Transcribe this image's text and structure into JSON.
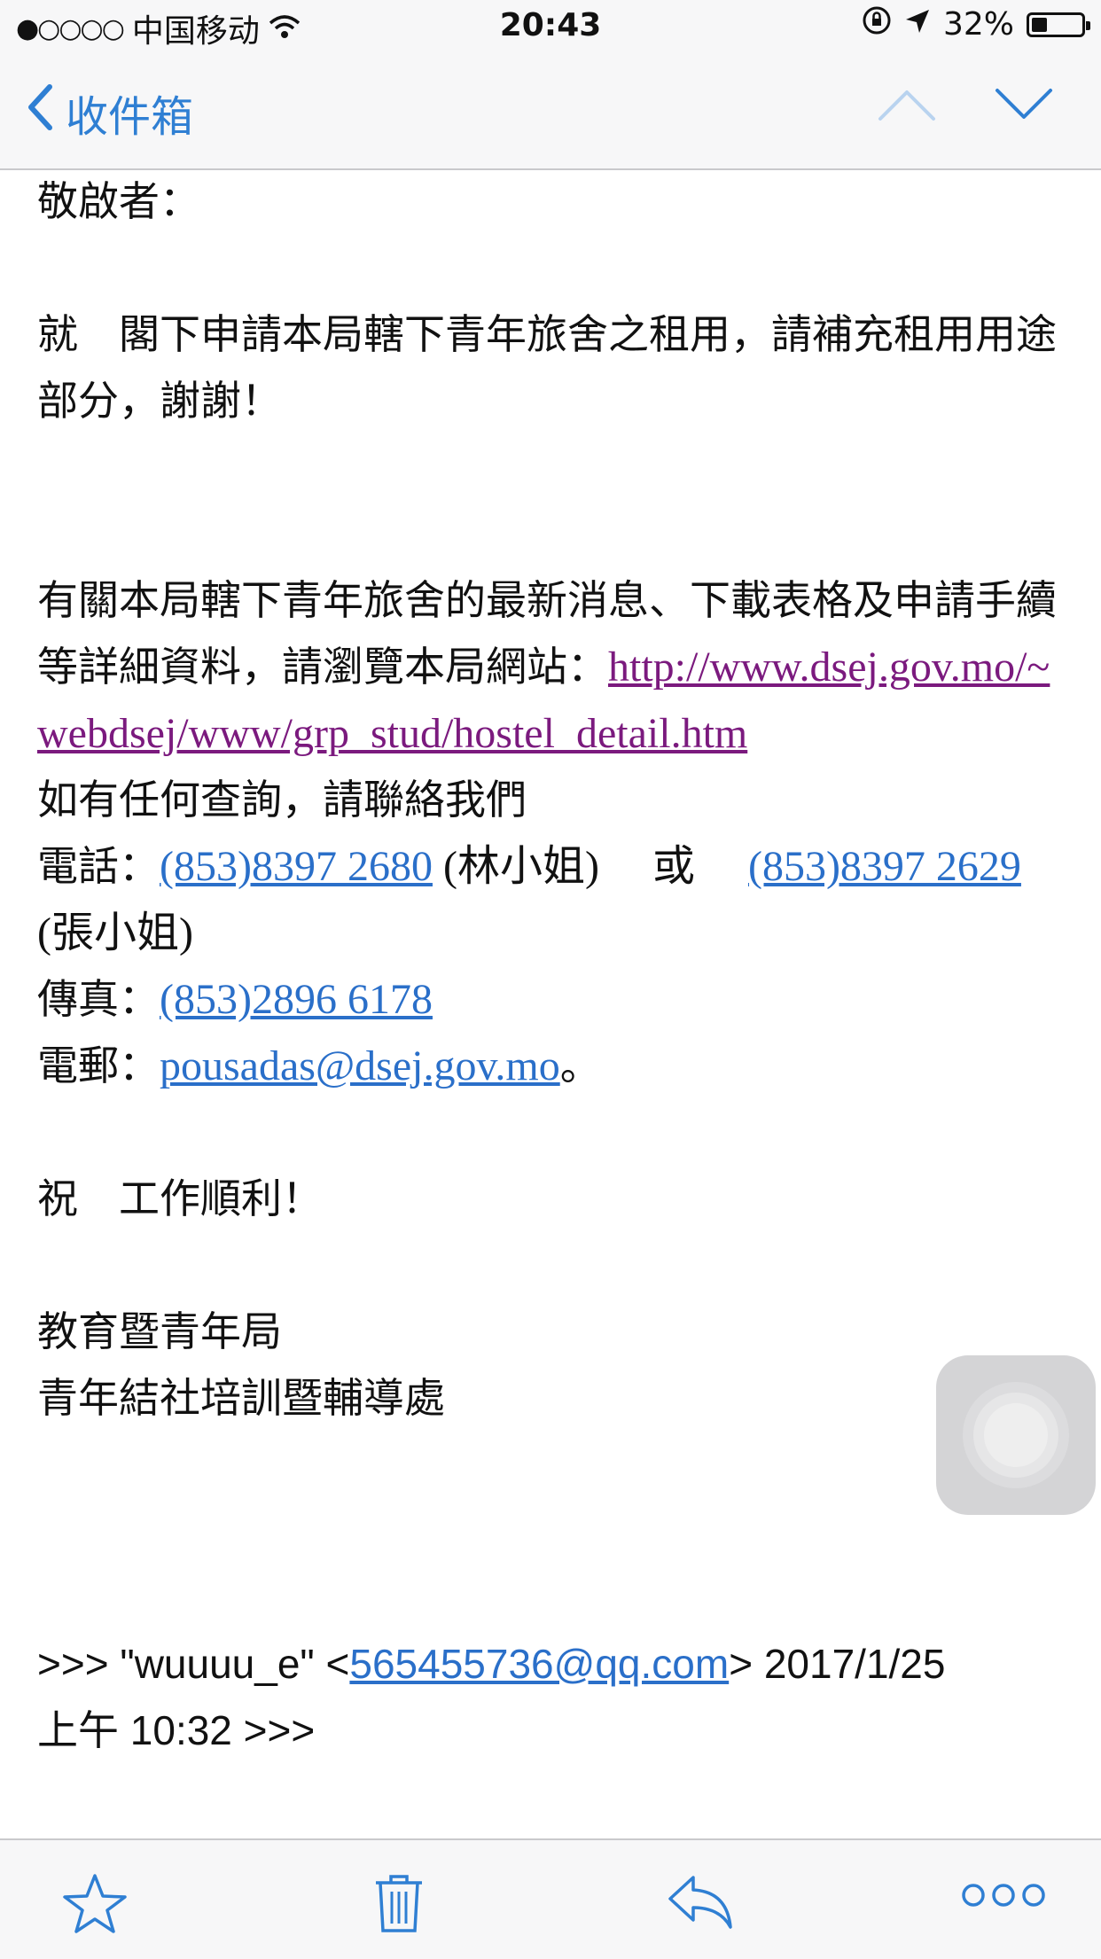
{
  "status_bar": {
    "signal_dots": "●○○○○",
    "carrier": "中国移动",
    "time": "20:43",
    "battery_percent": "32%",
    "battery_level": 0.32
  },
  "nav": {
    "back_label": "收件箱"
  },
  "email": {
    "salutation": "敬啟者：",
    "body_paragraph": "就　閣下申請本局轄下青年旅舍之租用，請補充租用用途部分，謝謝！",
    "info_text": "有關本局轄下青年旅舍的最新消息、下載表格及申請手續等詳細資料，請瀏覽本局網站：",
    "website_url": "http://www.dsej.gov.mo/~webdsej/www/grp_stud/hostel_detail.htm",
    "contact_intro": "如有任何查詢，請聯絡我們",
    "phone_label": "電話：",
    "phone1": "(853)8397 2680",
    "phone1_person": " (林小姐)　 或　 ",
    "phone2": "(853)8397 2629",
    "phone2_person": " (張小姐)",
    "fax_label": "傳真：",
    "fax": "(853)2896 6178",
    "email_label": "電郵：",
    "email_address": "pousadas@dsej.gov.mo",
    "email_suffix": "。",
    "closing": "祝　工作順利！",
    "signature_line1": "教育暨青年局",
    "signature_line2": "青年結社培訓暨輔導處",
    "quote_prefix": ">>> \"wuuuu_e\" <",
    "quote_email": "565455736@qq.com",
    "quote_suffix": "> 2017/1/25",
    "quote_line2": "上午 10:32 >>>"
  },
  "toolbar": {
    "icons": [
      "star-icon",
      "trash-icon",
      "reply-icon",
      "more-icon"
    ]
  },
  "colors": {
    "accent": "#2f7fd3",
    "link_purple": "#7b1a7e",
    "link_blue": "#2a6fc9"
  }
}
